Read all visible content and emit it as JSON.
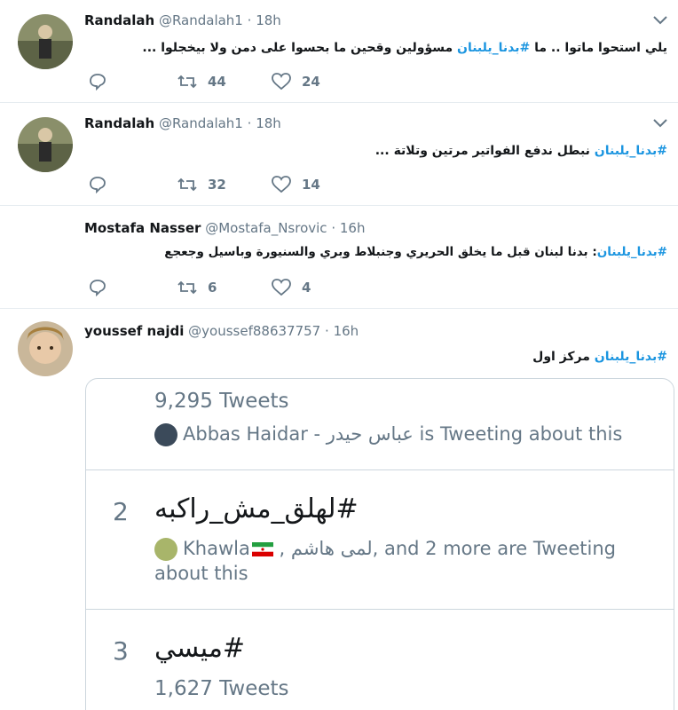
{
  "tweets": [
    {
      "name": "Randalah",
      "handle": "@Randalah1",
      "time": "18h",
      "text_plain_before": "يلي استحوا ماتوا .. ما ",
      "hashtag": "#بدنا_يلبنان",
      "text_plain_after": " مسؤولين وقحين ما بحسوا على دمن ولا بيخجلوا ...",
      "replies": "",
      "retweets": "44",
      "likes": "24"
    },
    {
      "name": "Randalah",
      "handle": "@Randalah1",
      "time": "18h",
      "text_plain_before": "",
      "hashtag": "#بدنا_يلبنان",
      "text_plain_after": " نبطل ندفع الفواتير مرتين وتلاتة ...",
      "replies": "",
      "retweets": "32",
      "likes": "14"
    },
    {
      "name": "Mostafa Nasser",
      "handle": "@Mostafa_Nsrovic",
      "time": "16h",
      "text_plain_before": "",
      "hashtag": "#بدنا_يلبنان",
      "text_plain_after": ": بدنا لبنان قبل ما يخلق الحريري وجنبلاط وبري والسنيورة وباسيل وجعجع",
      "replies": "",
      "retweets": "6",
      "likes": "4"
    },
    {
      "name": "youssef najdi",
      "handle": "@youssef88637757",
      "time": "16h",
      "text_plain_before": "",
      "hashtag": "#بدنا_يلبنان",
      "text_plain_after": " مركز اول"
    }
  ],
  "separator": "·",
  "trends_card": {
    "trend1": {
      "count": "9,295 Tweets",
      "who_name": "Abbas Haidar - عباس حيدر",
      "who_suffix": " is Tweeting about this"
    },
    "trend2": {
      "rank": "2",
      "name": "#لهلق_مش_راكبه",
      "who_line1_a": "Khawla",
      "who_line1_b": " , لمى هاشم, and 2 more are Tweeting",
      "who_line2": "about this"
    },
    "trend3": {
      "rank": "3",
      "name": "#ميسي",
      "count": "1,627 Tweets"
    }
  },
  "icons": {
    "reply": "reply-icon",
    "retweet": "retweet-icon",
    "like": "heart-icon",
    "caret": "chevron-down-icon",
    "flag": "iran-flag-icon"
  },
  "colors": {
    "hashtag": "#1b95e0",
    "secondary": "#657786",
    "border": "#e6ecf0"
  }
}
